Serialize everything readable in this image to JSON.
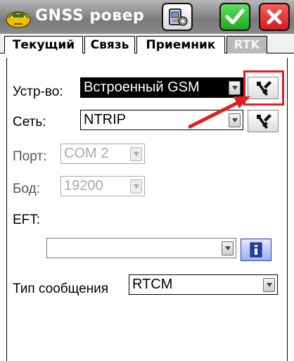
{
  "app": {
    "title": "GNSS ровер",
    "brand_color": "#f0c000"
  },
  "toolbar": {
    "settings_icon": "device-settings-icon",
    "ok_icon": "checkmark-icon",
    "cancel_icon": "close-icon"
  },
  "tabs": [
    {
      "label": "Текущий",
      "active": false
    },
    {
      "label": "Связь",
      "active": false
    },
    {
      "label": "Приемник",
      "active": false
    },
    {
      "label": "RTK",
      "active": true
    }
  ],
  "form": {
    "device": {
      "label": "Устр-во:",
      "value": "Встроенный GSM",
      "tool_icon": "tools-icon"
    },
    "network": {
      "label": "Сеть:",
      "value": "NTRIP",
      "tool_icon": "tools-icon"
    },
    "port": {
      "label": "Порт:",
      "value": "COM 2",
      "enabled": false
    },
    "baud": {
      "label": "Бод:",
      "value": "19200",
      "enabled": false
    },
    "eft": {
      "label": "EFT:",
      "value": "",
      "info_icon": "info-icon"
    },
    "message_type": {
      "label": "Тип сообщения",
      "value": "RTCM"
    }
  },
  "annotation": {
    "highlight_color": "#e02020"
  }
}
